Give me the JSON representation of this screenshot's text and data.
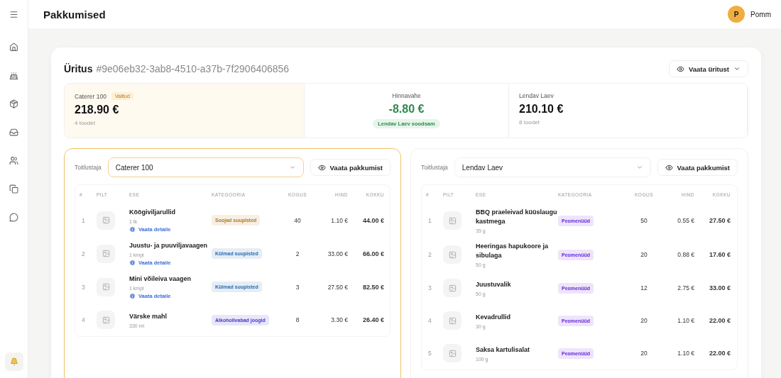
{
  "header": {
    "title": "Pakkumised",
    "user": {
      "initial": "P",
      "name": "Pomm"
    }
  },
  "event": {
    "label": "Üritus",
    "id": "#9e06eb32-3ab8-4510-a37b-7f2906406856",
    "view_button": "Vaata üritust"
  },
  "summary": {
    "left": {
      "name": "Caterer 100",
      "badge": "Valitud",
      "selected": true,
      "total": "218.90 €",
      "count": "4 toodet"
    },
    "middle": {
      "label": "Hinnavahe",
      "value": "-8.80 €",
      "badge": "Lendav Laev soodsam"
    },
    "right": {
      "name": "Lendav Laev",
      "selected": false,
      "total": "210.10 €",
      "count": "8 toodet"
    }
  },
  "panels": [
    {
      "selected": true,
      "label": "Toitlustaja",
      "caterer": "Caterer 100",
      "view_button": "Vaata pakkumist",
      "columns": [
        "#",
        "PILT",
        "ESE",
        "KATEGOORIA",
        "KOGUS",
        "HIND",
        "KOKKU"
      ],
      "rows": [
        {
          "index": "1",
          "name": "Köögiviljarullid",
          "unit": "1 tk",
          "link": "Vaata detaile",
          "category": "Soojad suupisted",
          "color": "#b7791f",
          "quantity": "40",
          "price": "1.10 €",
          "total": "44.00 €"
        },
        {
          "index": "2",
          "name": "Juustu- ja puuviljavaagen",
          "unit": "1 kmpl",
          "link": "Vaata detaile",
          "category": "Külmad suupisted",
          "color": "#2b6cb0",
          "quantity": "2",
          "price": "33.00 €",
          "total": "66.00 €"
        },
        {
          "index": "3",
          "name": "Mini võileiva vaagen",
          "unit": "1 kmpl",
          "link": "Vaata detaile",
          "category": "Külmad suupisted",
          "color": "#2b6cb0",
          "quantity": "3",
          "price": "27.50 €",
          "total": "82.50 €"
        },
        {
          "index": "4",
          "name": "Värske mahl",
          "unit": "330 ml",
          "category": "Alkoholivabad joogid",
          "color": "#4338ca",
          "quantity": "8",
          "price": "3.30 €",
          "total": "26.40 €"
        }
      ]
    },
    {
      "selected": false,
      "label": "Toitlustaja",
      "caterer": "Lendav Laev",
      "view_button": "Vaata pakkumist",
      "columns": [
        "#",
        "PILT",
        "ESE",
        "KATEGOORIA",
        "KOGUS",
        "HIND",
        "KOKKU"
      ],
      "rows": [
        {
          "index": "1",
          "name": "BBQ praeleivad küüslaugu kastmega",
          "unit": "35 g",
          "category": "Peomenüüd",
          "color": "#6d28d9",
          "quantity": "50",
          "price": "0.55 €",
          "total": "27.50 €"
        },
        {
          "index": "2",
          "name": "Heeringas hapukoore ja sibulaga",
          "unit": "50 g",
          "category": "Peomenüüd",
          "color": "#6d28d9",
          "quantity": "20",
          "price": "0.88 €",
          "total": "17.60 €"
        },
        {
          "index": "3",
          "name": "Juustuvalik",
          "unit": "50 g",
          "category": "Peomenüüd",
          "color": "#6d28d9",
          "quantity": "12",
          "price": "2.75 €",
          "total": "33.00 €"
        },
        {
          "index": "4",
          "name": "Kevadrullid",
          "unit": "30 g",
          "category": "Peomenüüd",
          "color": "#6d28d9",
          "quantity": "20",
          "price": "1.10 €",
          "total": "22.00 €"
        },
        {
          "index": "5",
          "name": "Saksa kartulisalat",
          "unit": "100 g",
          "category": "Peomenüüd",
          "color": "#6d28d9",
          "quantity": "20",
          "price": "1.10 €",
          "total": "22.00 €"
        }
      ]
    }
  ]
}
